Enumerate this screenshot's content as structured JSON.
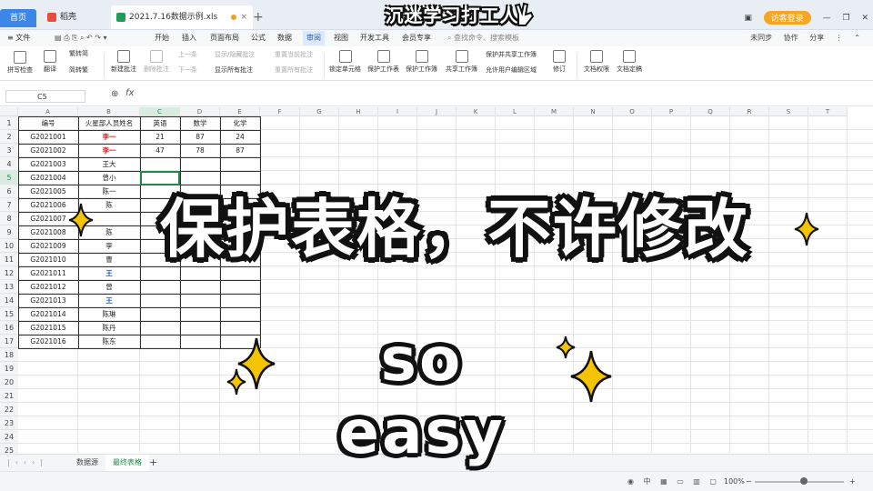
{
  "tabs": [
    {
      "label": "首页"
    },
    {
      "label": "稻壳"
    },
    {
      "label": "2021.7.16数据示例.xls"
    }
  ],
  "title_right": {
    "login": "访客登录"
  },
  "menu": {
    "items": [
      "文件",
      "开始",
      "插入",
      "页面布局",
      "公式",
      "数据",
      "审阅",
      "视图",
      "开发工具",
      "会员专享"
    ],
    "active": "审阅",
    "search_placeholder": "查找命令、搜索模板",
    "right": [
      "未同步",
      "协作",
      "分享"
    ]
  },
  "ribbon": {
    "buttons": [
      {
        "label": "拼写检查"
      },
      {
        "label": "翻译"
      },
      {
        "label": "繁转简"
      },
      {
        "label": "简转繁"
      },
      {
        "label": "新建批注"
      },
      {
        "label": "删除批注"
      },
      {
        "label": "上一条"
      },
      {
        "label": "下一条"
      },
      {
        "label": "显示/隐藏批注"
      },
      {
        "label": "显示所有批注"
      },
      {
        "label": "重置当前批注"
      },
      {
        "label": "重置所有批注"
      },
      {
        "label": "锁定单元格"
      },
      {
        "label": "保护工作表"
      },
      {
        "label": "保护工作簿"
      },
      {
        "label": "共享工作簿"
      },
      {
        "label": "保护并共享工作簿"
      },
      {
        "label": "允许用户编辑区域"
      },
      {
        "label": "修订"
      },
      {
        "label": "文档权限"
      },
      {
        "label": "文档定稿"
      }
    ]
  },
  "formula_bar": {
    "cell_ref": "C5",
    "fx": "fx"
  },
  "columns": [
    "A",
    "B",
    "C",
    "D",
    "E",
    "F",
    "G",
    "H",
    "I",
    "J",
    "K",
    "L",
    "M",
    "N",
    "O",
    "P",
    "Q",
    "R",
    "S",
    "T"
  ],
  "selected_column": "C",
  "selected_row": 5,
  "rows": [
    "1",
    "2",
    "3",
    "4",
    "5",
    "6",
    "7",
    "8",
    "9",
    "10",
    "11",
    "12",
    "13",
    "14",
    "15",
    "16",
    "17",
    "18",
    "19",
    "20",
    "21",
    "22",
    "23",
    "24",
    "25"
  ],
  "table": {
    "headers": [
      "编号",
      "火星部人员姓名",
      "英语",
      "数学",
      "化学"
    ],
    "rows": [
      {
        "id": "G2021001",
        "name": "李一",
        "name_style": "red",
        "english": "21",
        "math": "87",
        "chem": "24"
      },
      {
        "id": "G2021002",
        "name": "李一",
        "name_style": "red",
        "english": "47",
        "math": "78",
        "chem": "87"
      },
      {
        "id": "G2021003",
        "name": "王大",
        "name_style": "",
        "english": "",
        "math": "",
        "chem": ""
      },
      {
        "id": "G2021004",
        "name": "曾小",
        "name_style": "",
        "english": "",
        "math": "",
        "chem": ""
      },
      {
        "id": "G2021005",
        "name": "陈一",
        "name_style": "",
        "english": "",
        "math": "",
        "chem": ""
      },
      {
        "id": "G2021006",
        "name": "陈",
        "name_style": "",
        "english": "",
        "math": "",
        "chem": ""
      },
      {
        "id": "G2021007",
        "name": "",
        "name_style": "",
        "english": "",
        "math": "",
        "chem": ""
      },
      {
        "id": "G2021008",
        "name": "陈",
        "name_style": "",
        "english": "",
        "math": "",
        "chem": ""
      },
      {
        "id": "G2021009",
        "name": "李",
        "name_style": "",
        "english": "",
        "math": "",
        "chem": ""
      },
      {
        "id": "G2021010",
        "name": "曹",
        "name_style": "",
        "english": "",
        "math": "",
        "chem": ""
      },
      {
        "id": "G2021011",
        "name": "王",
        "name_style": "blue",
        "english": "",
        "math": "",
        "chem": ""
      },
      {
        "id": "G2021012",
        "name": "曾",
        "name_style": "",
        "english": "",
        "math": "",
        "chem": ""
      },
      {
        "id": "G2021013",
        "name": "王",
        "name_style": "blue",
        "english": "",
        "math": "",
        "chem": ""
      },
      {
        "id": "G2021014",
        "name": "陈琳",
        "name_style": "",
        "english": "",
        "math": "",
        "chem": ""
      },
      {
        "id": "G2021015",
        "name": "陈丹",
        "name_style": "",
        "english": "",
        "math": "",
        "chem": ""
      },
      {
        "id": "G2021016",
        "name": "陈东",
        "name_style": "",
        "english": "",
        "math": "",
        "chem": ""
      }
    ]
  },
  "sheets": {
    "tabs": [
      "数据源",
      "最终表格"
    ],
    "active": "最终表格"
  },
  "status": {
    "zoom": "100%"
  },
  "overlay": {
    "banner": "沉迷学习打工人",
    "title": "保护表格，不许修改",
    "subtitle": "so easy",
    "title_color": "#ffffff",
    "outline_color": "#111111",
    "sparkle_color": "#f5c400"
  }
}
